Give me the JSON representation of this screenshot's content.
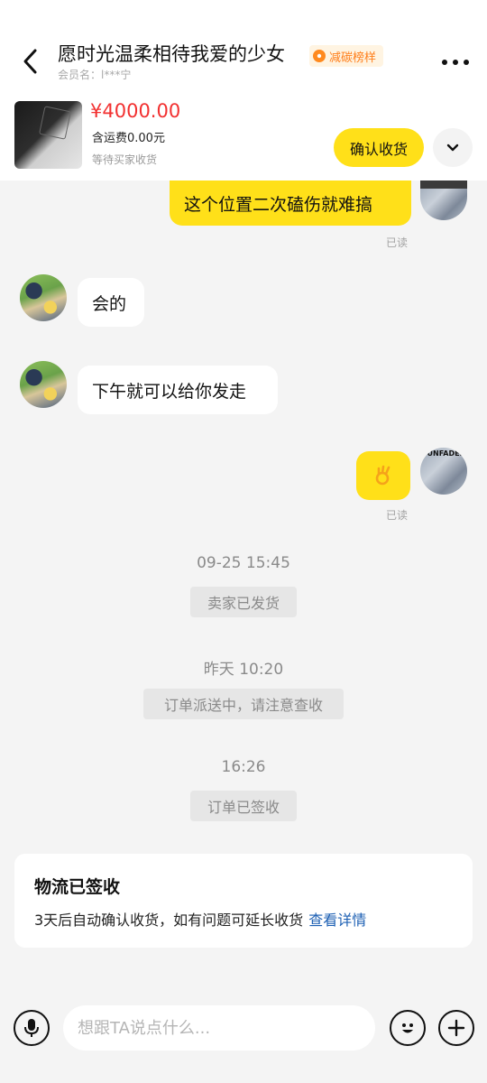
{
  "header": {
    "title": "愿时光温柔相待我爱的少女",
    "badge_label": "减碳榜样",
    "member_label": "会员名：l***宁"
  },
  "order": {
    "price": "¥4000.00",
    "shipping": "含运费0.00元",
    "status": "等待买家收货",
    "confirm_label": "确认收货"
  },
  "messages": [
    {
      "side": "self",
      "text": "这个位置二次磕伤就难搞",
      "read": "已读"
    },
    {
      "side": "other",
      "text": "会的"
    },
    {
      "side": "other",
      "text": "下午就可以给你发走"
    },
    {
      "side": "self",
      "emoji": "ok-hand-icon",
      "read": "已读"
    }
  ],
  "events": [
    {
      "time": "09-25 15:45",
      "text": "卖家已发货"
    },
    {
      "time": "昨天 10:20",
      "text": "订单派送中，请注意查收"
    },
    {
      "time": "16:26",
      "text": "订单已签收"
    }
  ],
  "logistics_card": {
    "title": "物流已签收",
    "body": "3天后自动确认收货，如有问题可延长收货",
    "link": "查看详情"
  },
  "input": {
    "placeholder": "想跟TA说点什么..."
  },
  "avatars": {
    "self_caption": "SUNFADED"
  },
  "colors": {
    "accent_yellow": "#ffe019",
    "price_red": "#f23030",
    "link_blue": "#1c5fb3",
    "badge_orange": "#ff7e1a"
  }
}
